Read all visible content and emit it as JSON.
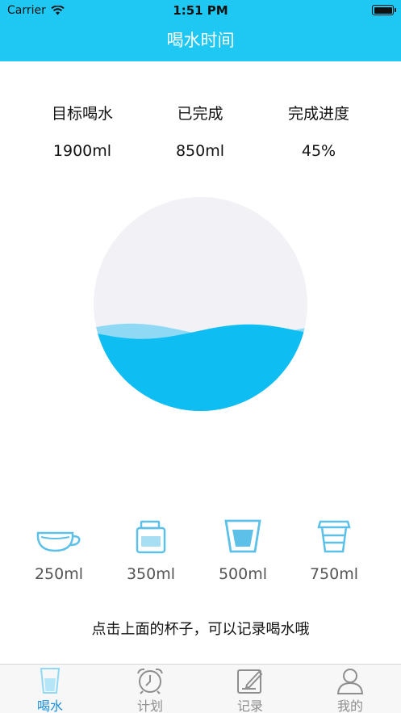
{
  "status_bar": {
    "carrier": "Carrier",
    "time": "1:51 PM"
  },
  "header": {
    "title": "喝水时间"
  },
  "stats": [
    {
      "label": "目标喝水",
      "value": "1900ml"
    },
    {
      "label": "已完成",
      "value": "850ml"
    },
    {
      "label": "完成进度",
      "value": "45%"
    }
  ],
  "progress": {
    "fraction": 0.45
  },
  "cups": [
    {
      "icon": "teacup-icon",
      "label": "250ml"
    },
    {
      "icon": "jar-icon",
      "label": "350ml"
    },
    {
      "icon": "glass-icon",
      "label": "500ml"
    },
    {
      "icon": "takeaway-cup-icon",
      "label": "750ml"
    }
  ],
  "hint": "点击上面的杯子，可以记录喝水哦",
  "tabs": [
    {
      "icon": "glass-icon",
      "label": "喝水",
      "active": true
    },
    {
      "icon": "alarm-clock-icon",
      "label": "计划",
      "active": false
    },
    {
      "icon": "edit-note-icon",
      "label": "记录",
      "active": false
    },
    {
      "icon": "person-icon",
      "label": "我的",
      "active": false
    }
  ],
  "colors": {
    "accent": "#1ec8f3",
    "water": "#0ebdf2",
    "water_light": "#8fd9f5",
    "active_tab": "#1a8fd8"
  }
}
